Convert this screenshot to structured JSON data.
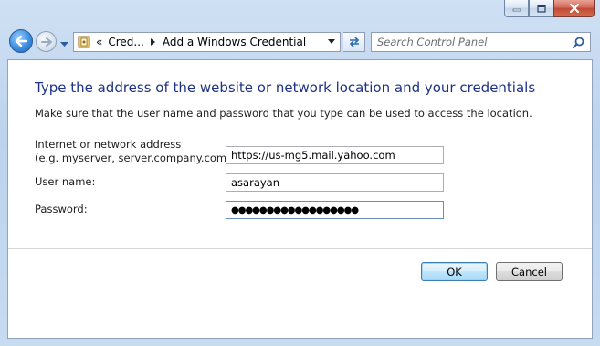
{
  "window": {
    "caption_buttons": [
      "minimize-icon",
      "maximize-icon",
      "close-icon"
    ]
  },
  "toolbar": {
    "breadcrumb": {
      "overflow": "«",
      "items": [
        "Cred...",
        "Add a Windows Credential"
      ]
    },
    "search_placeholder": "Search Control Panel"
  },
  "content": {
    "heading": "Type the address of the website or network location and your credentials",
    "subtext": "Make sure that the user name and password that you type can be used to access the location.",
    "fields": {
      "address": {
        "label_line1": "Internet or network address",
        "label_line2": "(e.g. myserver, server.company.com):",
        "value": "https://us-mg5.mail.yahoo.com"
      },
      "username": {
        "label": "User name:",
        "value": "asarayan"
      },
      "password": {
        "label": "Password:",
        "value": "●●●●●●●●●●●●●●●●●●"
      }
    },
    "buttons": {
      "ok": "OK",
      "cancel": "Cancel"
    }
  },
  "colors": {
    "heading": "#1e3287",
    "frame": "#c7dbf1",
    "close_button": "#c04a35"
  }
}
